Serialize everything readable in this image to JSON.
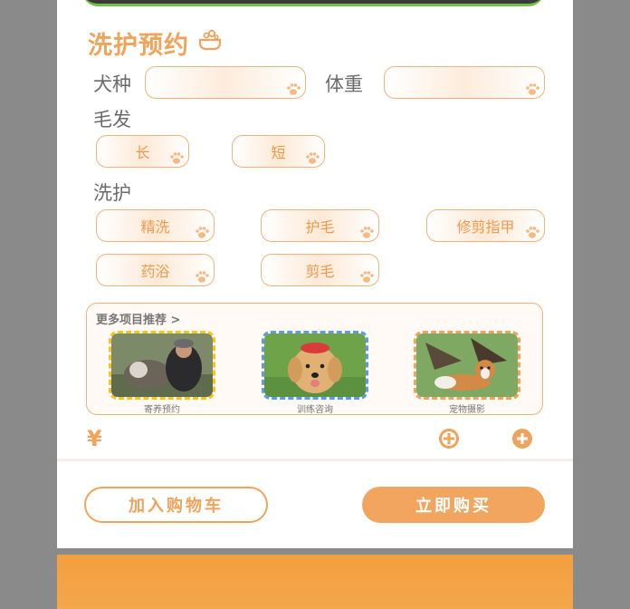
{
  "section": {
    "title": "洗护预约",
    "icon": "bathtub-icon"
  },
  "fields": {
    "breed_label": "犬种",
    "breed_value": "",
    "weight_label": "体重",
    "weight_value": ""
  },
  "hair": {
    "label": "毛发",
    "options": [
      "长",
      "短"
    ]
  },
  "care": {
    "label": "洗护",
    "options": [
      "精洗",
      "护毛",
      "修剪指甲",
      "药浴",
      "剪毛"
    ]
  },
  "recommend": {
    "title": "更多项目推荐 >",
    "items": [
      {
        "caption": "寄养预约",
        "border_color": "#f5c518"
      },
      {
        "caption": "训练咨询",
        "border_color": "#5b9bea"
      },
      {
        "caption": "宠物摄影",
        "border_color": "#f0a35a"
      }
    ]
  },
  "price": {
    "currency": "¥",
    "value": ""
  },
  "actions": {
    "add_to_cart": "加入购物车",
    "buy_now": "立即购买"
  },
  "colors": {
    "accent": "#f0a35a",
    "accent_light": "#fde9d6",
    "text": "#6b6b6b"
  }
}
